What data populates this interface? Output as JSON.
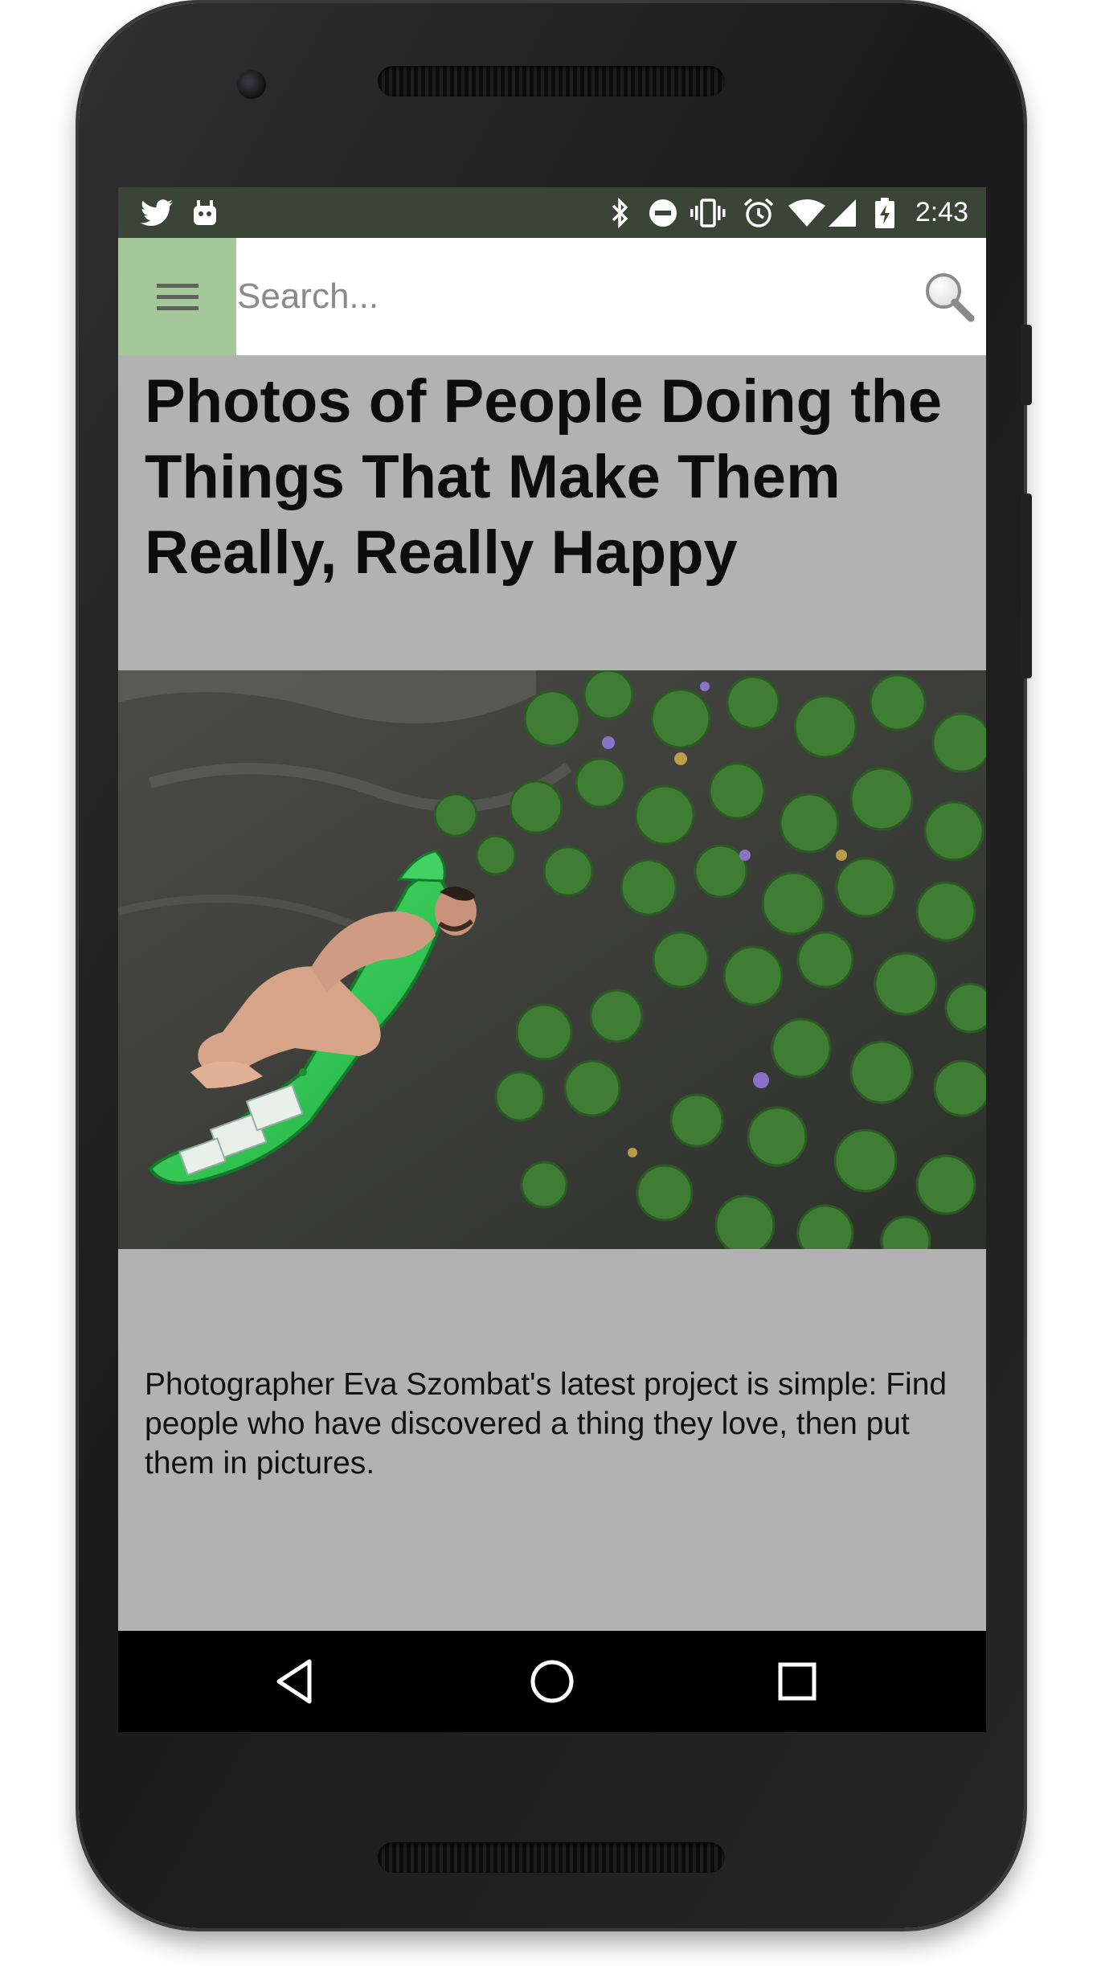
{
  "status_bar": {
    "time": "2:43",
    "left_icons": [
      "twitter-icon",
      "android-icon"
    ],
    "right_icons": [
      "bluetooth-icon",
      "do-not-disturb-icon",
      "vibrate-icon",
      "alarm-icon",
      "wifi-icon",
      "cell-signal-icon",
      "battery-charging-icon"
    ],
    "background_color": "#3a4437"
  },
  "toolbar": {
    "search_placeholder": "Search...",
    "search_value": "",
    "menu_button_color": "#a5c89a"
  },
  "article": {
    "title": "Photos of People Doing the Things That Make Them Really, Really Happy",
    "summary": "Photographer Eva Szombat's latest project is simple: Find people who have discovered a thing they love, then put them in pictures.",
    "background_color": "#b2b2b2"
  },
  "nav_bar": {
    "buttons": [
      "back-icon",
      "home-icon",
      "recents-icon"
    ]
  }
}
